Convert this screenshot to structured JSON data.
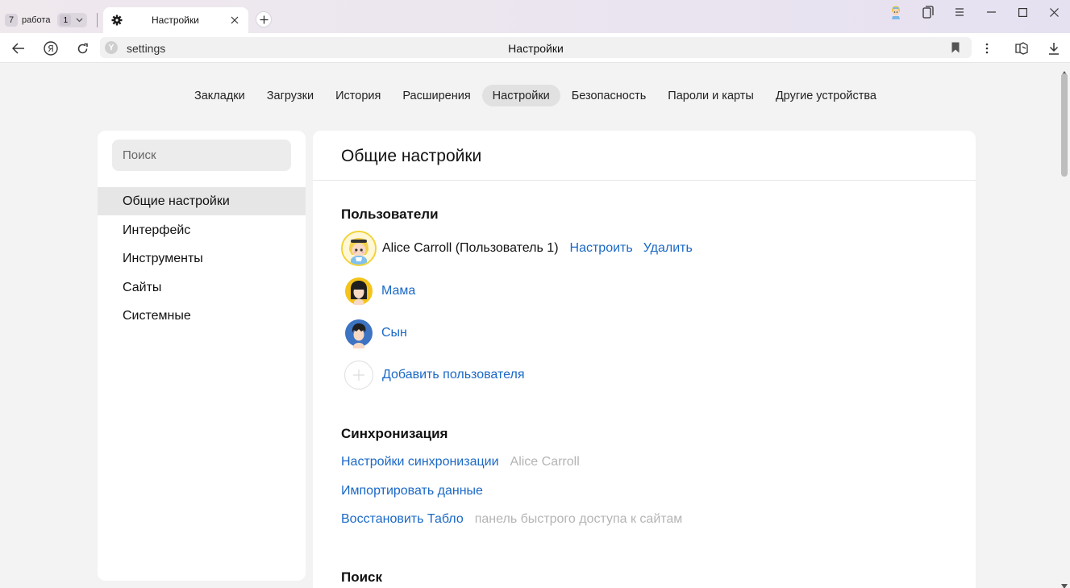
{
  "tabbar": {
    "workspace_number": "7",
    "workspace_name": "работа",
    "tab_count": "1",
    "active_tab_title": "Настройки"
  },
  "toolbar": {
    "url": "settings",
    "page_title": "Настройки"
  },
  "topnav": {
    "items": [
      {
        "label": "Закладки"
      },
      {
        "label": "Загрузки"
      },
      {
        "label": "История"
      },
      {
        "label": "Расширения"
      },
      {
        "label": "Настройки",
        "active": true
      },
      {
        "label": "Безопасность"
      },
      {
        "label": "Пароли и карты"
      },
      {
        "label": "Другие устройства"
      }
    ]
  },
  "sidebar": {
    "search_placeholder": "Поиск",
    "items": [
      {
        "label": "Общие настройки",
        "active": true
      },
      {
        "label": "Интерфейс"
      },
      {
        "label": "Инструменты"
      },
      {
        "label": "Сайты"
      },
      {
        "label": "Системные"
      }
    ]
  },
  "main": {
    "title": "Общие настройки",
    "users": {
      "heading": "Пользователи",
      "current": {
        "name": "Alice Carroll (Пользователь 1)",
        "configure_label": "Настроить",
        "delete_label": "Удалить"
      },
      "others": [
        {
          "name": "Мама"
        },
        {
          "name": "Сын"
        }
      ],
      "add_label": "Добавить пользователя"
    },
    "sync": {
      "heading": "Синхронизация",
      "settings_label": "Настройки синхронизации",
      "account": "Alice Carroll",
      "import_label": "Импортировать данные",
      "restore_label": "Восстановить Табло",
      "restore_hint": "панель быстрого доступа к сайтам"
    },
    "search": {
      "heading": "Поиск"
    }
  },
  "colors": {
    "link": "#1a68c6",
    "hint": "#b4b4b4",
    "page_bg": "#f3f3f3",
    "active_item_bg": "#e6e6e6"
  }
}
